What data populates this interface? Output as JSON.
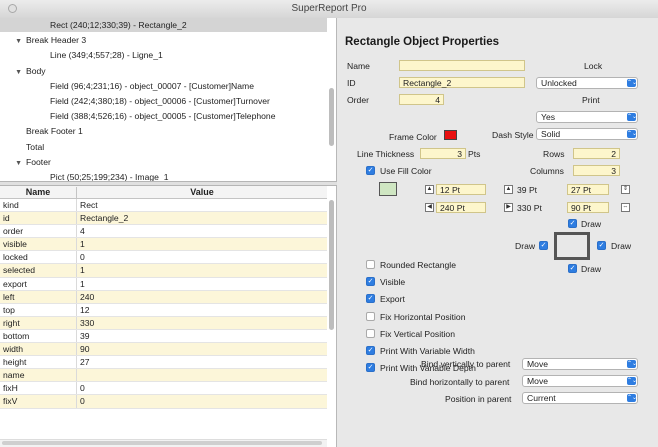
{
  "window": {
    "title": "SuperReport Pro"
  },
  "tree": [
    {
      "text": "Rect (240;12;330;39) - Rectangle_2",
      "indent": 3,
      "tri": "",
      "selected": true
    },
    {
      "text": "Break Header 3",
      "indent": 1,
      "tri": "▼"
    },
    {
      "text": "Line (349;4;557;28) - Ligne_1",
      "indent": 3,
      "tri": ""
    },
    {
      "text": "Body",
      "indent": 1,
      "tri": "▼"
    },
    {
      "text": "Field (96;4;231;16) - object_00007 - [Customer]Name",
      "indent": 3,
      "tri": ""
    },
    {
      "text": "Field (242;4;380;18) - object_00006 - [Customer]Turnover",
      "indent": 3,
      "tri": ""
    },
    {
      "text": "Field (388;4;526;16) - object_00005 - [Customer]Telephone",
      "indent": 3,
      "tri": ""
    },
    {
      "text": "Break Footer 1",
      "indent": 1,
      "tri": ""
    },
    {
      "text": "Total",
      "indent": 1,
      "tri": ""
    },
    {
      "text": "Footer",
      "indent": 1,
      "tri": "▼"
    },
    {
      "text": "Pict (50;25;199;234) - Image_1",
      "indent": 3,
      "tri": ""
    }
  ],
  "grid": {
    "col_name": "Name",
    "col_value": "Value",
    "rows": [
      {
        "k": "kind",
        "v": "Rect",
        "hl": false
      },
      {
        "k": "id",
        "v": "Rectangle_2",
        "hl": true
      },
      {
        "k": "order",
        "v": "4",
        "hl": false
      },
      {
        "k": "visible",
        "v": "1",
        "hl": true
      },
      {
        "k": "locked",
        "v": "0",
        "hl": false
      },
      {
        "k": "selected",
        "v": "1",
        "hl": true
      },
      {
        "k": "export",
        "v": "1",
        "hl": false
      },
      {
        "k": "left",
        "v": "240",
        "hl": true
      },
      {
        "k": "top",
        "v": "12",
        "hl": false
      },
      {
        "k": "right",
        "v": "330",
        "hl": true
      },
      {
        "k": "bottom",
        "v": "39",
        "hl": false
      },
      {
        "k": "width",
        "v": "90",
        "hl": true
      },
      {
        "k": "height",
        "v": "27",
        "hl": false
      },
      {
        "k": "name",
        "v": "",
        "hl": true
      },
      {
        "k": "fixH",
        "v": "0",
        "hl": false
      },
      {
        "k": "fixV",
        "v": "0",
        "hl": true
      }
    ]
  },
  "panel": {
    "title": "Rectangle Object Properties",
    "name_label": "Name",
    "name_value": "",
    "id_label": "ID",
    "id_value": "Rectangle_2",
    "order_label": "Order",
    "order_value": "4",
    "lock_label": "Lock",
    "lock_value": "Unlocked",
    "print_label": "Print",
    "print_value": "Yes",
    "frame_color_label": "Frame Color",
    "frame_color": "#e81010",
    "dash_style_label": "Dash Style",
    "dash_style_value": "Solid",
    "line_thickness_label": "Line Thickness",
    "line_thickness_value": "3",
    "line_thickness_unit": "Pts",
    "rows_label": "Rows",
    "rows_value": "2",
    "use_fill_label": "Use Fill Color",
    "fill_color": "#cfe6c2",
    "columns_label": "Columns",
    "columns_value": "3",
    "top_offset": "12 Pt",
    "left_offset": "240 Pt",
    "mid_top": "39 Pt",
    "mid_left": "330 Pt",
    "right_top": "27 Pt",
    "right_left": "90 Pt",
    "draw_label": "Draw",
    "checkboxes": [
      {
        "label": "Rounded Rectangle",
        "checked": false
      },
      {
        "label": "Visible",
        "checked": true
      },
      {
        "label": "Export",
        "checked": true
      },
      {
        "label": "Fix Horizontal Position",
        "checked": false
      },
      {
        "label": "Fix Vertical Position",
        "checked": false
      },
      {
        "label": "Print With Variable Width",
        "checked": true
      },
      {
        "label": "Print With Variable Depth",
        "checked": true
      }
    ],
    "bind_v_label": "Bind vertically to parent",
    "bind_v_value": "Move",
    "bind_h_label": "Bind horizontally to parent",
    "bind_h_value": "Move",
    "position_label": "Position in parent",
    "position_value": "Current"
  }
}
